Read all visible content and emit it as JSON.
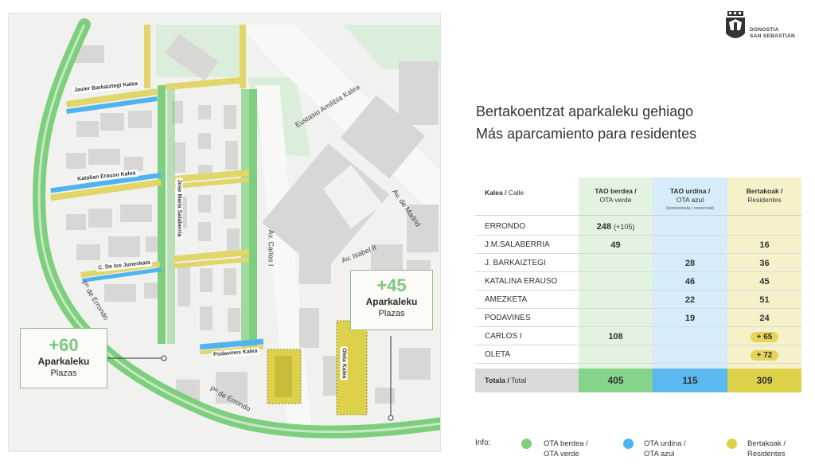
{
  "logo": {
    "line1": "DONOSTIA",
    "line2": "SAN SEBASTIÁN"
  },
  "title_eu": "Bertakoentzat aparkaleku gehiago",
  "title_es": "Más aparcamiento para residentes",
  "map": {
    "streets": {
      "javier": "Javier Barkaiztegi Kalea",
      "katalina": "Katalian Erauso Kalea",
      "juneskata": "C. De los Juneskata",
      "salaberria": "Jose Maria Salaberria",
      "podavines": "Podavines Kalea",
      "oleta": "Oleta Kalea",
      "eustasio": "Eustasio Amilibia Kalea",
      "carlos": "Av. Carlos I",
      "madrid": "Av. de Madrid",
      "isabel": "Av. Isabel II",
      "errondo1": "Pº de Errondo",
      "errondo2": "Pº de Errondo"
    },
    "callout_left": {
      "number": "+60",
      "label1": "Aparkaleku",
      "label2": "Plazas"
    },
    "callout_right": {
      "number": "+45",
      "label1": "Aparkaleku",
      "label2": "Plazas"
    }
  },
  "table": {
    "headers": {
      "street_bold": "Kalea /",
      "street_rest": " Calle",
      "green_bold": "TAO berdea /",
      "green_rest": "OTA verde",
      "blue_bold": "TAO urdina  /",
      "blue_rest": "OTA azul",
      "blue_small": "(komertziala / comercial)",
      "yellow_bold": "Bertakoak /",
      "yellow_rest": "Residentes"
    },
    "rows": [
      {
        "name": "ERRONDO",
        "green": "248",
        "green_extra": "(+105)",
        "blue": "",
        "yellow": ""
      },
      {
        "name": "J.M.SALABERRIA",
        "green": "49",
        "green_extra": "",
        "blue": "",
        "yellow": "16"
      },
      {
        "name": "J. BARKAIZTEGI",
        "green": "",
        "green_extra": "",
        "blue": "28",
        "yellow": "36"
      },
      {
        "name": "KATALINA ERAUSO",
        "green": "",
        "green_extra": "",
        "blue": "46",
        "yellow": "45"
      },
      {
        "name": "AMEZKETA",
        "green": "",
        "green_extra": "",
        "blue": "22",
        "yellow": "51"
      },
      {
        "name": "PODAVINES",
        "green": "",
        "green_extra": "",
        "blue": "19",
        "yellow": "24"
      },
      {
        "name": "CARLOS I",
        "green": "108",
        "green_extra": "",
        "blue": "",
        "yellow": "+ 65"
      },
      {
        "name": "OLETA",
        "green": "",
        "green_extra": "",
        "blue": "",
        "yellow": "+ 72"
      }
    ],
    "total": {
      "label_bold": "Totala /",
      "label_rest": " Total",
      "green": "405",
      "blue": "115",
      "yellow": "309"
    }
  },
  "legend": {
    "lead": "Info:",
    "items": [
      {
        "line1": "OTA berdea /",
        "line2": "OTA verde",
        "color": "#7fd07f"
      },
      {
        "line1": "OTA urdina /",
        "line2": "OTA azul",
        "color": "#4fb3f0"
      },
      {
        "line1": "Bertakoak /",
        "line2": "Residentes",
        "color": "#ddd14a"
      }
    ]
  },
  "colors": {
    "green": "#7dcf7d",
    "blue": "#4fb3f0",
    "yellow": "#ddd14a",
    "block": "#d9d9d7",
    "park": "#dbeedb"
  }
}
